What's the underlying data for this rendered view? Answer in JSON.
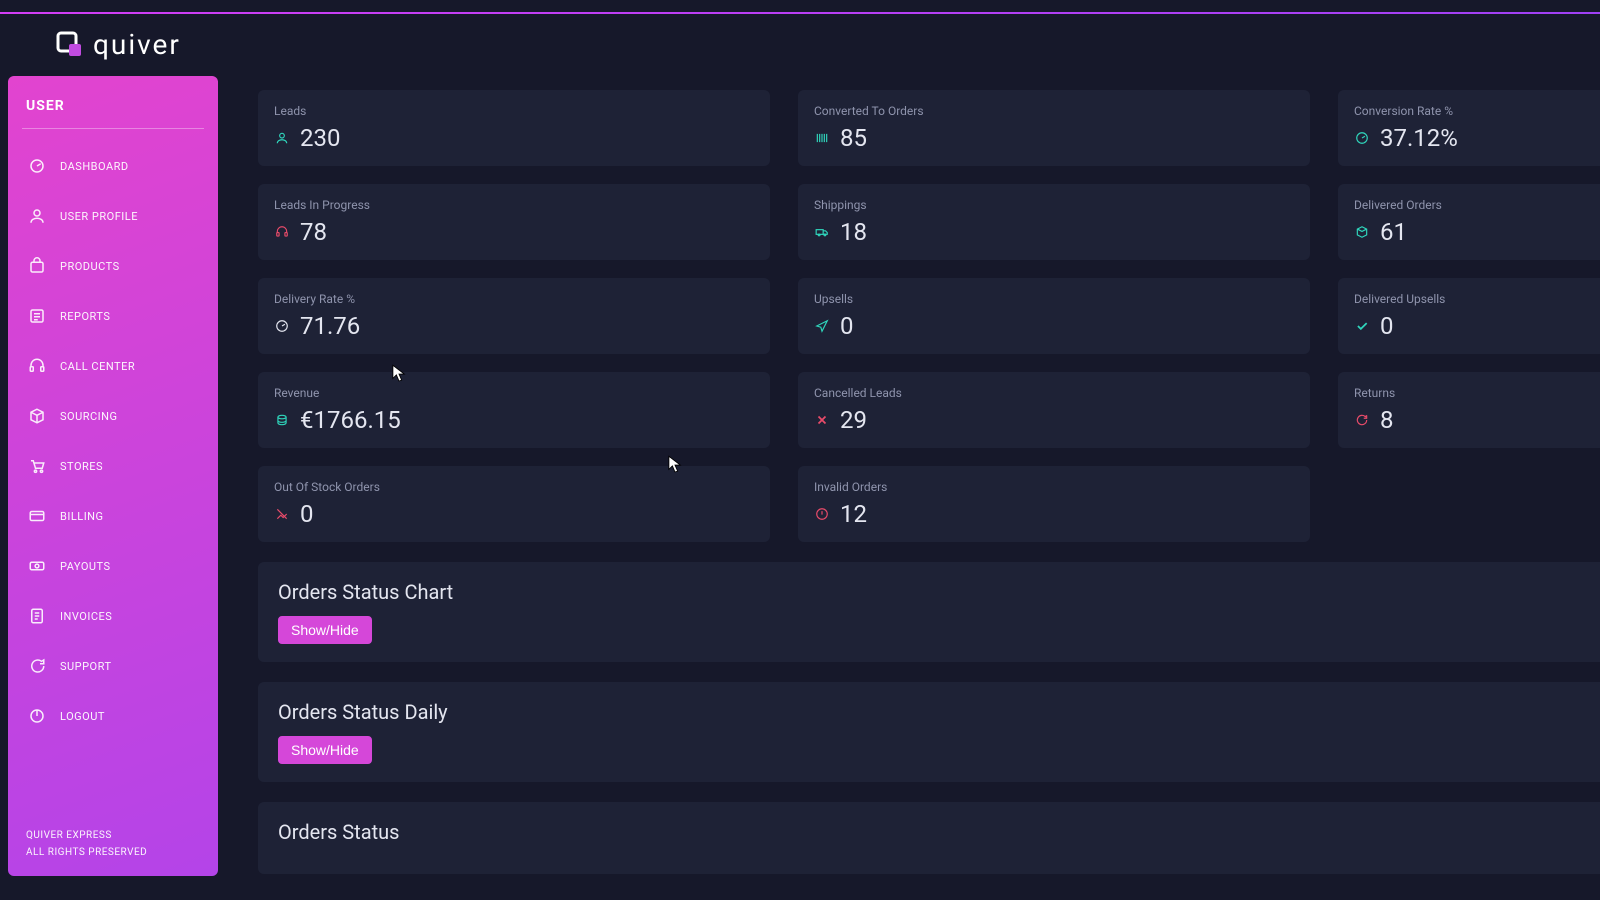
{
  "brand": {
    "name": "quiver"
  },
  "sidebar": {
    "title": "USER",
    "items": [
      {
        "label": "DASHBOARD",
        "icon": "dashboard-icon"
      },
      {
        "label": "USER PROFILE",
        "icon": "user-icon"
      },
      {
        "label": "PRODUCTS",
        "icon": "bag-icon"
      },
      {
        "label": "REPORTS",
        "icon": "report-icon"
      },
      {
        "label": "CALL CENTER",
        "icon": "headset-icon"
      },
      {
        "label": "SOURCING",
        "icon": "cube-icon"
      },
      {
        "label": "STORES",
        "icon": "cart-icon"
      },
      {
        "label": "BILLING",
        "icon": "card-icon"
      },
      {
        "label": "PAYOUTS",
        "icon": "money-icon"
      },
      {
        "label": "INVOICES",
        "icon": "invoice-icon"
      },
      {
        "label": "SUPPORT",
        "icon": "chat-icon"
      },
      {
        "label": "LOGOUT",
        "icon": "power-icon"
      }
    ],
    "footer1": "QUIVER EXPRESS",
    "footer2": "ALL RIGHTS PRESERVED"
  },
  "cards": {
    "leads": {
      "label": "Leads",
      "value": "230",
      "color": "teal",
      "icon": "user-icon"
    },
    "converted": {
      "label": "Converted To Orders",
      "value": "85",
      "color": "teal",
      "icon": "barcode-icon"
    },
    "conversion_rate": {
      "label": "Conversion Rate %",
      "value": "37.12%",
      "color": "teal",
      "icon": "gauge-icon"
    },
    "leads_progress": {
      "label": "Leads In Progress",
      "value": "78",
      "color": "red",
      "icon": "headset-icon"
    },
    "shippings": {
      "label": "Shippings",
      "value": "18",
      "color": "teal",
      "icon": "truck-icon"
    },
    "delivered": {
      "label": "Delivered Orders",
      "value": "61",
      "color": "teal",
      "icon": "box-icon"
    },
    "delivery_rate": {
      "label": "Delivery Rate %",
      "value": "71.76",
      "color": "white",
      "icon": "gauge-icon"
    },
    "upsells": {
      "label": "Upsells",
      "value": "0",
      "color": "teal",
      "icon": "send-icon"
    },
    "delivered_upsells": {
      "label": "Delivered Upsells",
      "value": "0",
      "color": "teal",
      "icon": "check-icon"
    },
    "revenue": {
      "label": "Revenue",
      "value": "€1766.15",
      "color": "teal",
      "icon": "coins-icon"
    },
    "cancelled": {
      "label": "Cancelled Leads",
      "value": "29",
      "color": "red",
      "icon": "x-icon"
    },
    "returns": {
      "label": "Returns",
      "value": "8",
      "color": "red",
      "icon": "refresh-icon"
    },
    "out_of_stock": {
      "label": "Out Of Stock Orders",
      "value": "0",
      "color": "red",
      "icon": "chart-broken-icon"
    },
    "invalid": {
      "label": "Invalid Orders",
      "value": "12",
      "color": "red",
      "icon": "alert-icon"
    }
  },
  "panels": {
    "status_chart": {
      "title": "Orders Status Chart",
      "toggle": "Show/Hide"
    },
    "status_daily": {
      "title": "Orders Status Daily",
      "toggle": "Show/Hide"
    },
    "status": {
      "title": "Orders Status"
    }
  }
}
